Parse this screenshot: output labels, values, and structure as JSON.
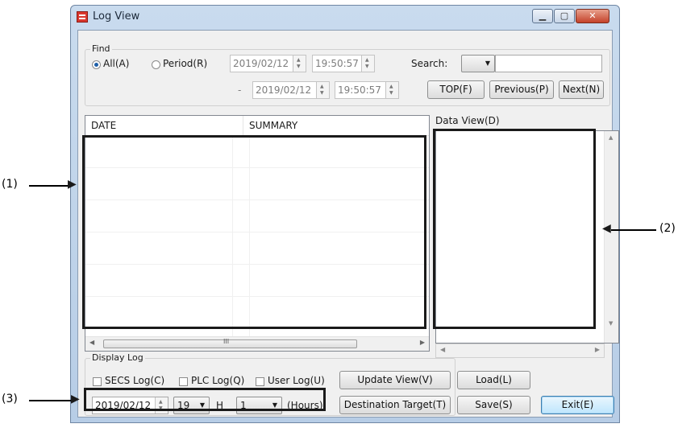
{
  "window": {
    "title": "Log View"
  },
  "window_controls": {
    "minimize": "▁",
    "maximize": "▢",
    "close": "✕"
  },
  "find": {
    "group_label": "Find",
    "all_label": "All(A)",
    "period_label": "Period(R)",
    "from_date": "2019/02/12",
    "from_time": "19:50:57",
    "to_dash": "-",
    "to_date": "2019/02/12",
    "to_time": "19:50:57",
    "search_label": "Search:",
    "search_value": "",
    "top_button": "TOP(F)",
    "previous_button": "Previous(P)",
    "next_button": "Next(N)"
  },
  "log_table": {
    "columns": [
      "DATE",
      "SUMMARY"
    ],
    "scroll_glyph": "III"
  },
  "data_view": {
    "label": "Data View(D)"
  },
  "display_log": {
    "group_label": "Display Log",
    "secs_label": "SECS Log(C)",
    "plc_label": "PLC Log(Q)",
    "user_label": "User Log(U)",
    "date": "2019/02/12",
    "hour": "19",
    "hour_unit": "H",
    "span": "1",
    "span_unit": "(Hours)"
  },
  "buttons": {
    "update_view": "Update View(V)",
    "destination_target": "Destination Target(T)",
    "load": "Load(L)",
    "save": "Save(S)",
    "exit": "Exit(E)"
  },
  "callouts": {
    "c1": "(1)",
    "c2": "(2)",
    "c3": "(3)"
  }
}
